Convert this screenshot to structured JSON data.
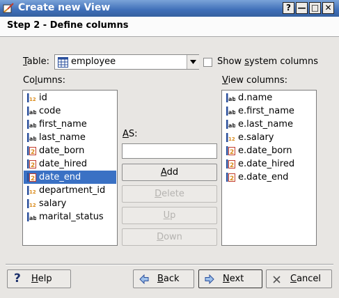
{
  "window": {
    "title": "Create new View"
  },
  "window_buttons": {
    "help": "?",
    "minimize": "—",
    "maximize": "□",
    "close": "✕"
  },
  "step": {
    "title": "Step 2 - Define columns"
  },
  "table": {
    "label_pre": "",
    "label_ul": "T",
    "label_post": "able:",
    "value": "employee"
  },
  "show_system": {
    "label_pre": "Show ",
    "label_ul": "s",
    "label_post": "ystem columns",
    "checked": false
  },
  "columns": {
    "label_pre": "Co",
    "label_ul": "l",
    "label_post": "umns:",
    "items": [
      {
        "name": "id",
        "type": "int"
      },
      {
        "name": "code",
        "type": "text"
      },
      {
        "name": "first_name",
        "type": "text"
      },
      {
        "name": "last_name",
        "type": "text"
      },
      {
        "name": "date_born",
        "type": "date"
      },
      {
        "name": "date_hired",
        "type": "date"
      },
      {
        "name": "date_end",
        "type": "date",
        "selected": true
      },
      {
        "name": "department_id",
        "type": "int"
      },
      {
        "name": "salary",
        "type": "int"
      },
      {
        "name": "marital_status",
        "type": "text"
      }
    ]
  },
  "as": {
    "label_pre": "",
    "label_ul": "A",
    "label_post": "S:",
    "value": ""
  },
  "buttons": {
    "add_pre": "",
    "add_ul": "A",
    "add_post": "dd",
    "delete_pre": "",
    "delete_ul": "D",
    "delete_post": "elete",
    "up_pre": "",
    "up_ul": "U",
    "up_post": "p",
    "down_pre": "",
    "down_ul": "D",
    "down_post": "own"
  },
  "view_columns": {
    "label_pre": "",
    "label_ul": "V",
    "label_post": "iew columns:",
    "items": [
      {
        "name": "d.name",
        "type": "text"
      },
      {
        "name": "e.first_name",
        "type": "text"
      },
      {
        "name": "e.last_name",
        "type": "text"
      },
      {
        "name": "e.salary",
        "type": "int"
      },
      {
        "name": "e.date_born",
        "type": "date"
      },
      {
        "name": "e.date_hired",
        "type": "date"
      },
      {
        "name": "e.date_end",
        "type": "date"
      }
    ]
  },
  "footer": {
    "help_pre": "",
    "help_ul": "H",
    "help_post": "elp",
    "back_pre": "",
    "back_ul": "B",
    "back_post": "ack",
    "next_pre": "",
    "next_ul": "N",
    "next_post": "ext",
    "cancel_pre": "",
    "cancel_ul": "C",
    "cancel_post": "ancel"
  },
  "type_icons": {
    "int": "12",
    "text": "ab",
    "date": "calendar"
  },
  "colors": {
    "titlebar": "#3f6fb8",
    "selection": "#3a71c4",
    "icon_blue": "#2a4f9c",
    "icon_orange": "#d98a1a",
    "icon_red": "#c23a2a"
  }
}
